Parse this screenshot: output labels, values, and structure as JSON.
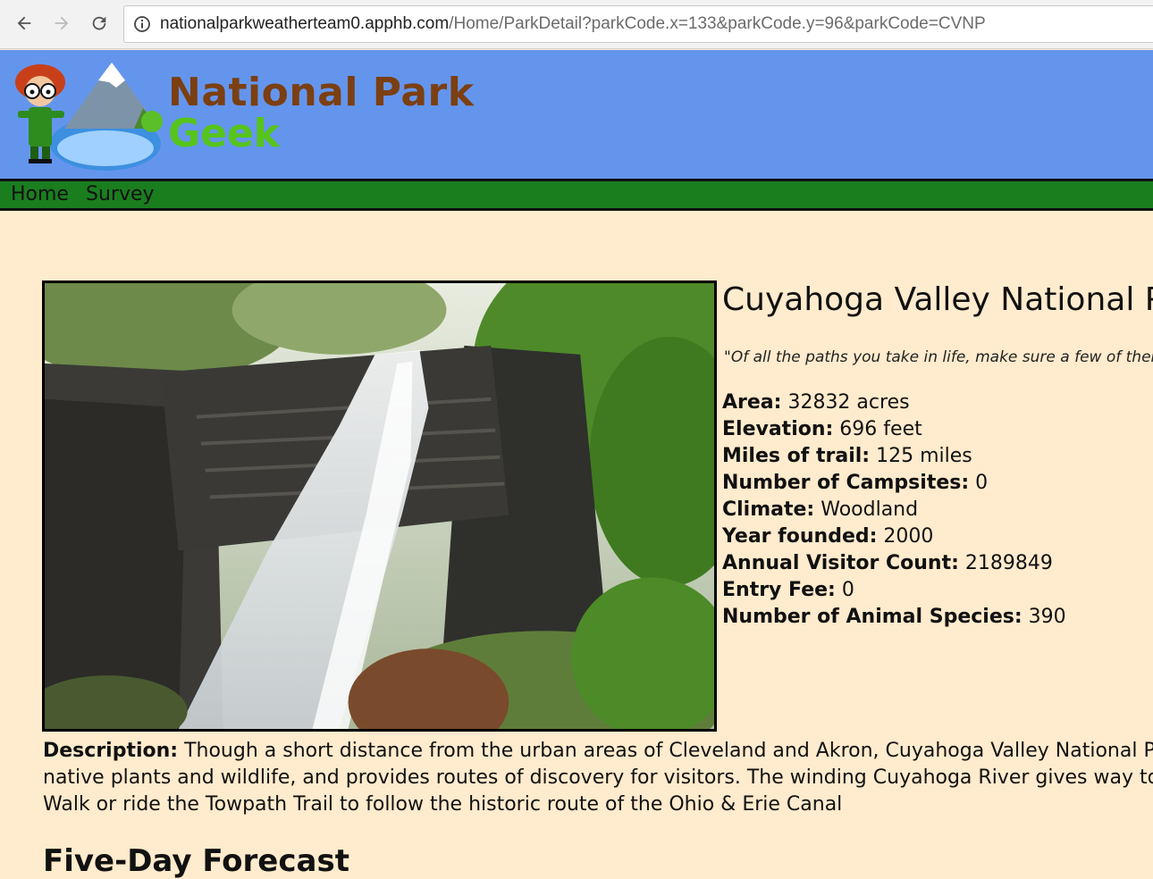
{
  "browser": {
    "url_host": "nationalparkweatherteam0.apphb.com",
    "url_path": "/Home/ParkDetail?parkCode.x=133&parkCode.y=96&parkCode=CVNP",
    "icons": [
      "back-arrow-icon",
      "forward-arrow-icon",
      "reload-icon",
      "info-icon"
    ]
  },
  "header": {
    "brand_line1": "National Park",
    "brand_line2": "Geek",
    "colors": {
      "header_bg": "#6495ed",
      "nav_bg": "#1a7d1e",
      "page_bg": "#ffebcd"
    }
  },
  "nav": {
    "home": "Home",
    "survey": "Survey"
  },
  "park": {
    "title": "Cuyahoga Valley National Pa",
    "quote": "\"Of all the paths you take in life, make sure a few of them a",
    "facts": [
      {
        "label": "Area:",
        "value": " 32832 acres"
      },
      {
        "label": "Elevation:",
        "value": " 696 feet"
      },
      {
        "label": "Miles of trail:",
        "value": " 125 miles"
      },
      {
        "label": "Number of Campsites:",
        "value": " 0"
      },
      {
        "label": "Climate:",
        "value": " Woodland"
      },
      {
        "label": "Year founded:",
        "value": " 2000"
      },
      {
        "label": "Annual Visitor Count:",
        "value": " 2189849"
      },
      {
        "label": "Entry Fee:",
        "value": " 0"
      },
      {
        "label": "Number of Animal Species:",
        "value": " 390"
      }
    ],
    "description_label": "Description:",
    "description_text": " Though a short distance from the urban areas of Cleveland and Akron, Cuyahoga Valley National Pa native plants and wildlife, and provides routes of discovery for visitors. The winding Cuyahoga River gives way to Walk or ride the Towpath Trail to follow the historic route of the Ohio & Erie Canal"
  },
  "forecast": {
    "heading": "Five-Day Forecast"
  }
}
